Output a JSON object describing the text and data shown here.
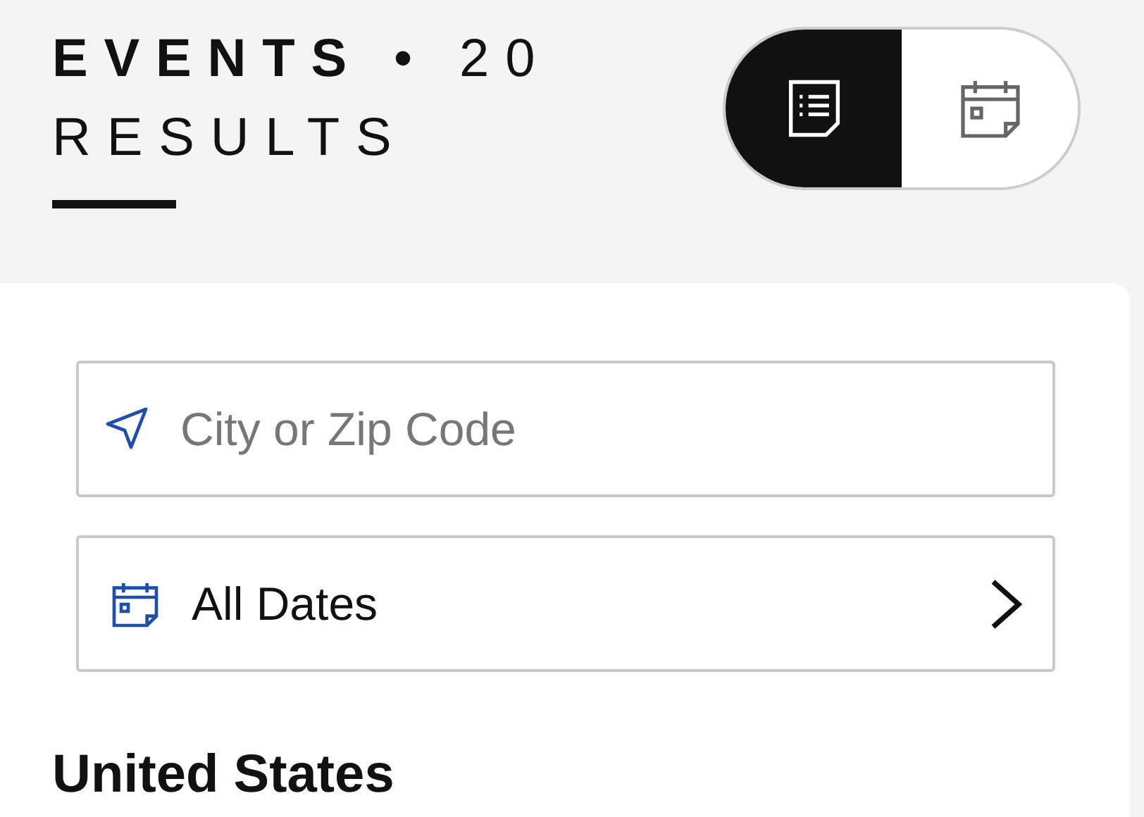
{
  "heading": "**EVENTS** • 20 RESULTS",
  "view_toggle": [
    {
      "kind": "list",
      "selected": true
    },
    {
      "kind": "calendar",
      "selected": false
    }
  ],
  "location_field": {
    "placeholder": "City or Zip Code"
  },
  "date_filter": {
    "label": "All Dates"
  },
  "section_heading": "United States"
}
